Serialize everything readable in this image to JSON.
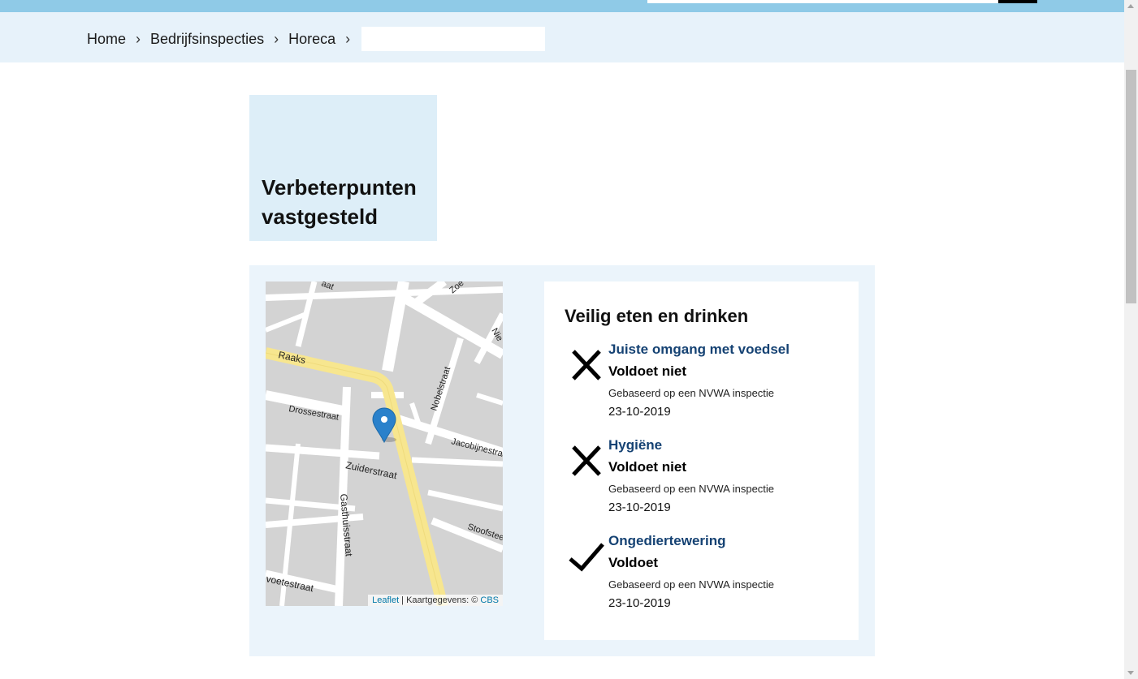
{
  "breadcrumb": {
    "items": [
      "Home",
      "Bedrijfsinspecties",
      "Horeca"
    ],
    "current": ""
  },
  "page": {
    "title_line1": "Verbeterpunten",
    "title_line2": "vastgesteld"
  },
  "map": {
    "streets": [
      "Raaks",
      "Drossestraat",
      "Zuiderstraat",
      "Gasthuisstraat",
      "Nobelstraat",
      "Jacobijnestraat",
      "Stoofsteeg",
      "voetestraat",
      "Zoe",
      "Nie",
      "aat"
    ],
    "attribution_leaflet": "Leaflet",
    "attribution_sep": " | Kaartgegevens: © ",
    "attribution_source": "CBS"
  },
  "results": {
    "heading": "Veilig eten en drinken",
    "items": [
      {
        "name": "Juiste omgang met voedsel",
        "verdict": "Voldoet niet",
        "basis": "Gebaseerd op een NVWA inspectie",
        "date": "23-10-2019",
        "icon": "cross-icon"
      },
      {
        "name": "Hygiëne",
        "verdict": "Voldoet niet",
        "basis": "Gebaseerd op een NVWA inspectie",
        "date": "23-10-2019",
        "icon": "cross-icon"
      },
      {
        "name": "Ongediertewering",
        "verdict": "Voldoet",
        "basis": "Gebaseerd op een NVWA inspectie",
        "date": "23-10-2019",
        "icon": "check-icon"
      }
    ]
  },
  "colors": {
    "topbar": "#8fcae7",
    "crumbbar": "#e7f2fa",
    "title_box": "#ddeef8",
    "panel": "#ebf4fb",
    "link": "#154273",
    "highlight_road": "#f7e68f",
    "marker": "#2a81cb"
  }
}
